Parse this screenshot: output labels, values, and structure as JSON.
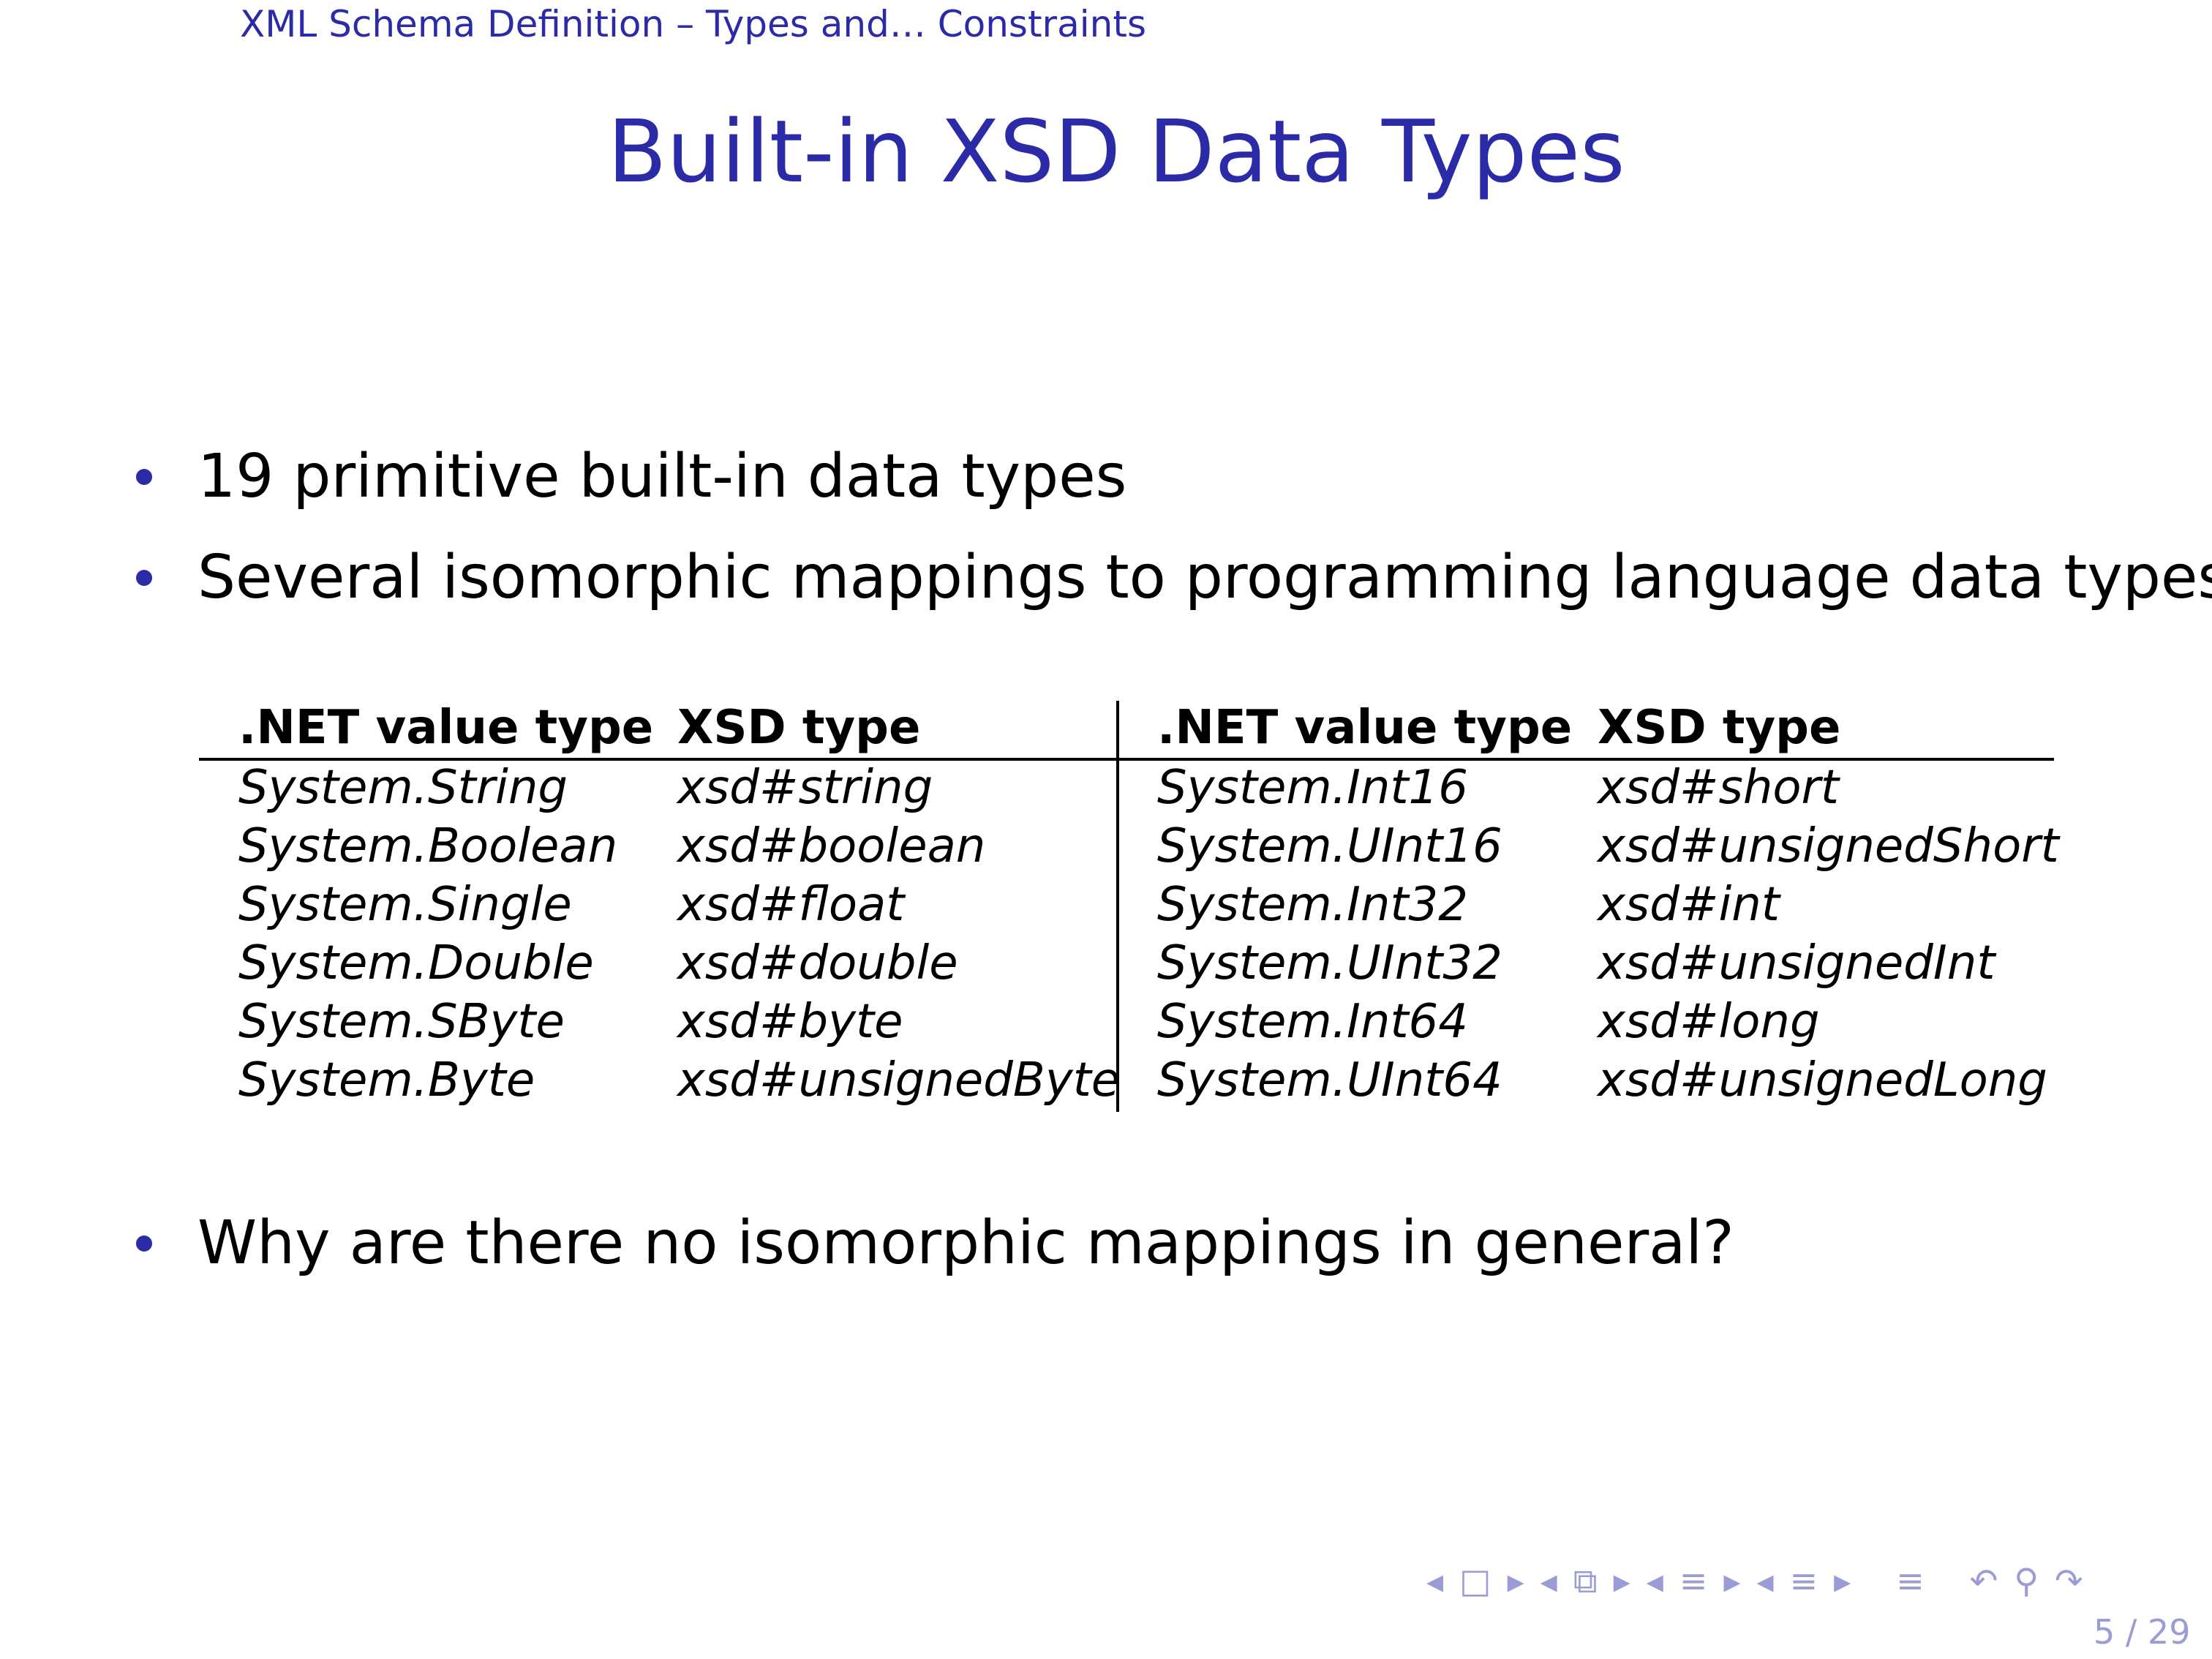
{
  "header": {
    "section_title": "XML Schema Definition – Types and… Constraints"
  },
  "slide": {
    "title": "Built-in XSD Data Types",
    "bullets": [
      "19 primitive built-in data types",
      "Several isomorphic mappings to programming language data types",
      "Why are there no isomorphic mappings in general?"
    ]
  },
  "table": {
    "headers": [
      ".NET value type",
      "XSD type",
      ".NET value type",
      "XSD type"
    ],
    "rows": [
      [
        "System.String",
        "xsd#string",
        "System.Int16",
        "xsd#short"
      ],
      [
        "System.Boolean",
        "xsd#boolean",
        "System.UInt16",
        "xsd#unsignedShort"
      ],
      [
        "System.Single",
        "xsd#float",
        "System.Int32",
        "xsd#int"
      ],
      [
        "System.Double",
        "xsd#double",
        "System.UInt32",
        "xsd#unsignedInt"
      ],
      [
        "System.SByte",
        "xsd#byte",
        "System.Int64",
        "xsd#long"
      ],
      [
        "System.Byte",
        "xsd#unsignedByte",
        "System.UInt64",
        "xsd#unsignedLong"
      ]
    ]
  },
  "navigation": {
    "icons": [
      "nav-prev-frame-icon",
      "nav-frame-icon",
      "nav-next-frame-icon",
      "nav-prev-subsection-icon",
      "nav-subsection-icon",
      "nav-next-subsection-icon",
      "nav-prev-section-icon",
      "nav-section-icon",
      "nav-next-section-icon",
      "nav-prev-part-icon",
      "nav-part-icon",
      "nav-next-part-icon",
      "nav-document-icon",
      "nav-back-icon",
      "nav-search-icon",
      "nav-forward-icon"
    ],
    "page_number": "5 / 29"
  },
  "colors": {
    "accent": "#2b2ba8",
    "nav": "#9b9bd6",
    "text": "#000000",
    "background": "#ffffff"
  }
}
